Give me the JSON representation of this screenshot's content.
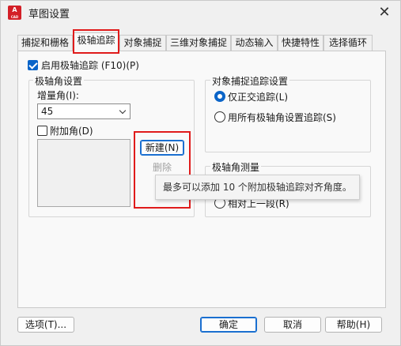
{
  "window": {
    "title": "草图设置",
    "icon_text": "A",
    "icon_sub": "CAD",
    "close_glyph": "✕"
  },
  "tabs": [
    {
      "label": "捕捉和栅格"
    },
    {
      "label": "极轴追踪"
    },
    {
      "label": "对象捕捉"
    },
    {
      "label": "三维对象捕捉"
    },
    {
      "label": "动态输入"
    },
    {
      "label": "快捷特性"
    },
    {
      "label": "选择循环"
    }
  ],
  "active_tab": "极轴追踪",
  "polar": {
    "enable_label": "启用极轴追踪 (F10)(P)",
    "enable_checked": true,
    "angle_settings_title": "极轴角设置",
    "increment_label": "增量角(I):",
    "increment_value": "45",
    "additional_label": "附加角(D)",
    "additional_checked": false,
    "new_button": "新建(N)",
    "delete_button": "删除"
  },
  "snap_tracking": {
    "title": "对象捕捉追踪设置",
    "options": [
      {
        "label": "仅正交追踪(L)",
        "checked": true
      },
      {
        "label": "用所有极轴角设置追踪(S)",
        "checked": false
      }
    ]
  },
  "measurement": {
    "title": "极轴角测量",
    "relative_partial": "相对上一段(R)"
  },
  "tooltip": {
    "text": "最多可以添加 10 个附加极轴追踪对齐角度。"
  },
  "footer": {
    "options_button": "选项(T)...",
    "ok_button": "确定",
    "cancel_button": "取消",
    "help_button": "帮助(H)"
  },
  "colors": {
    "accent": "#0a64c8",
    "highlight_outline": "#e01b1b",
    "icon_red": "#d31f27"
  }
}
